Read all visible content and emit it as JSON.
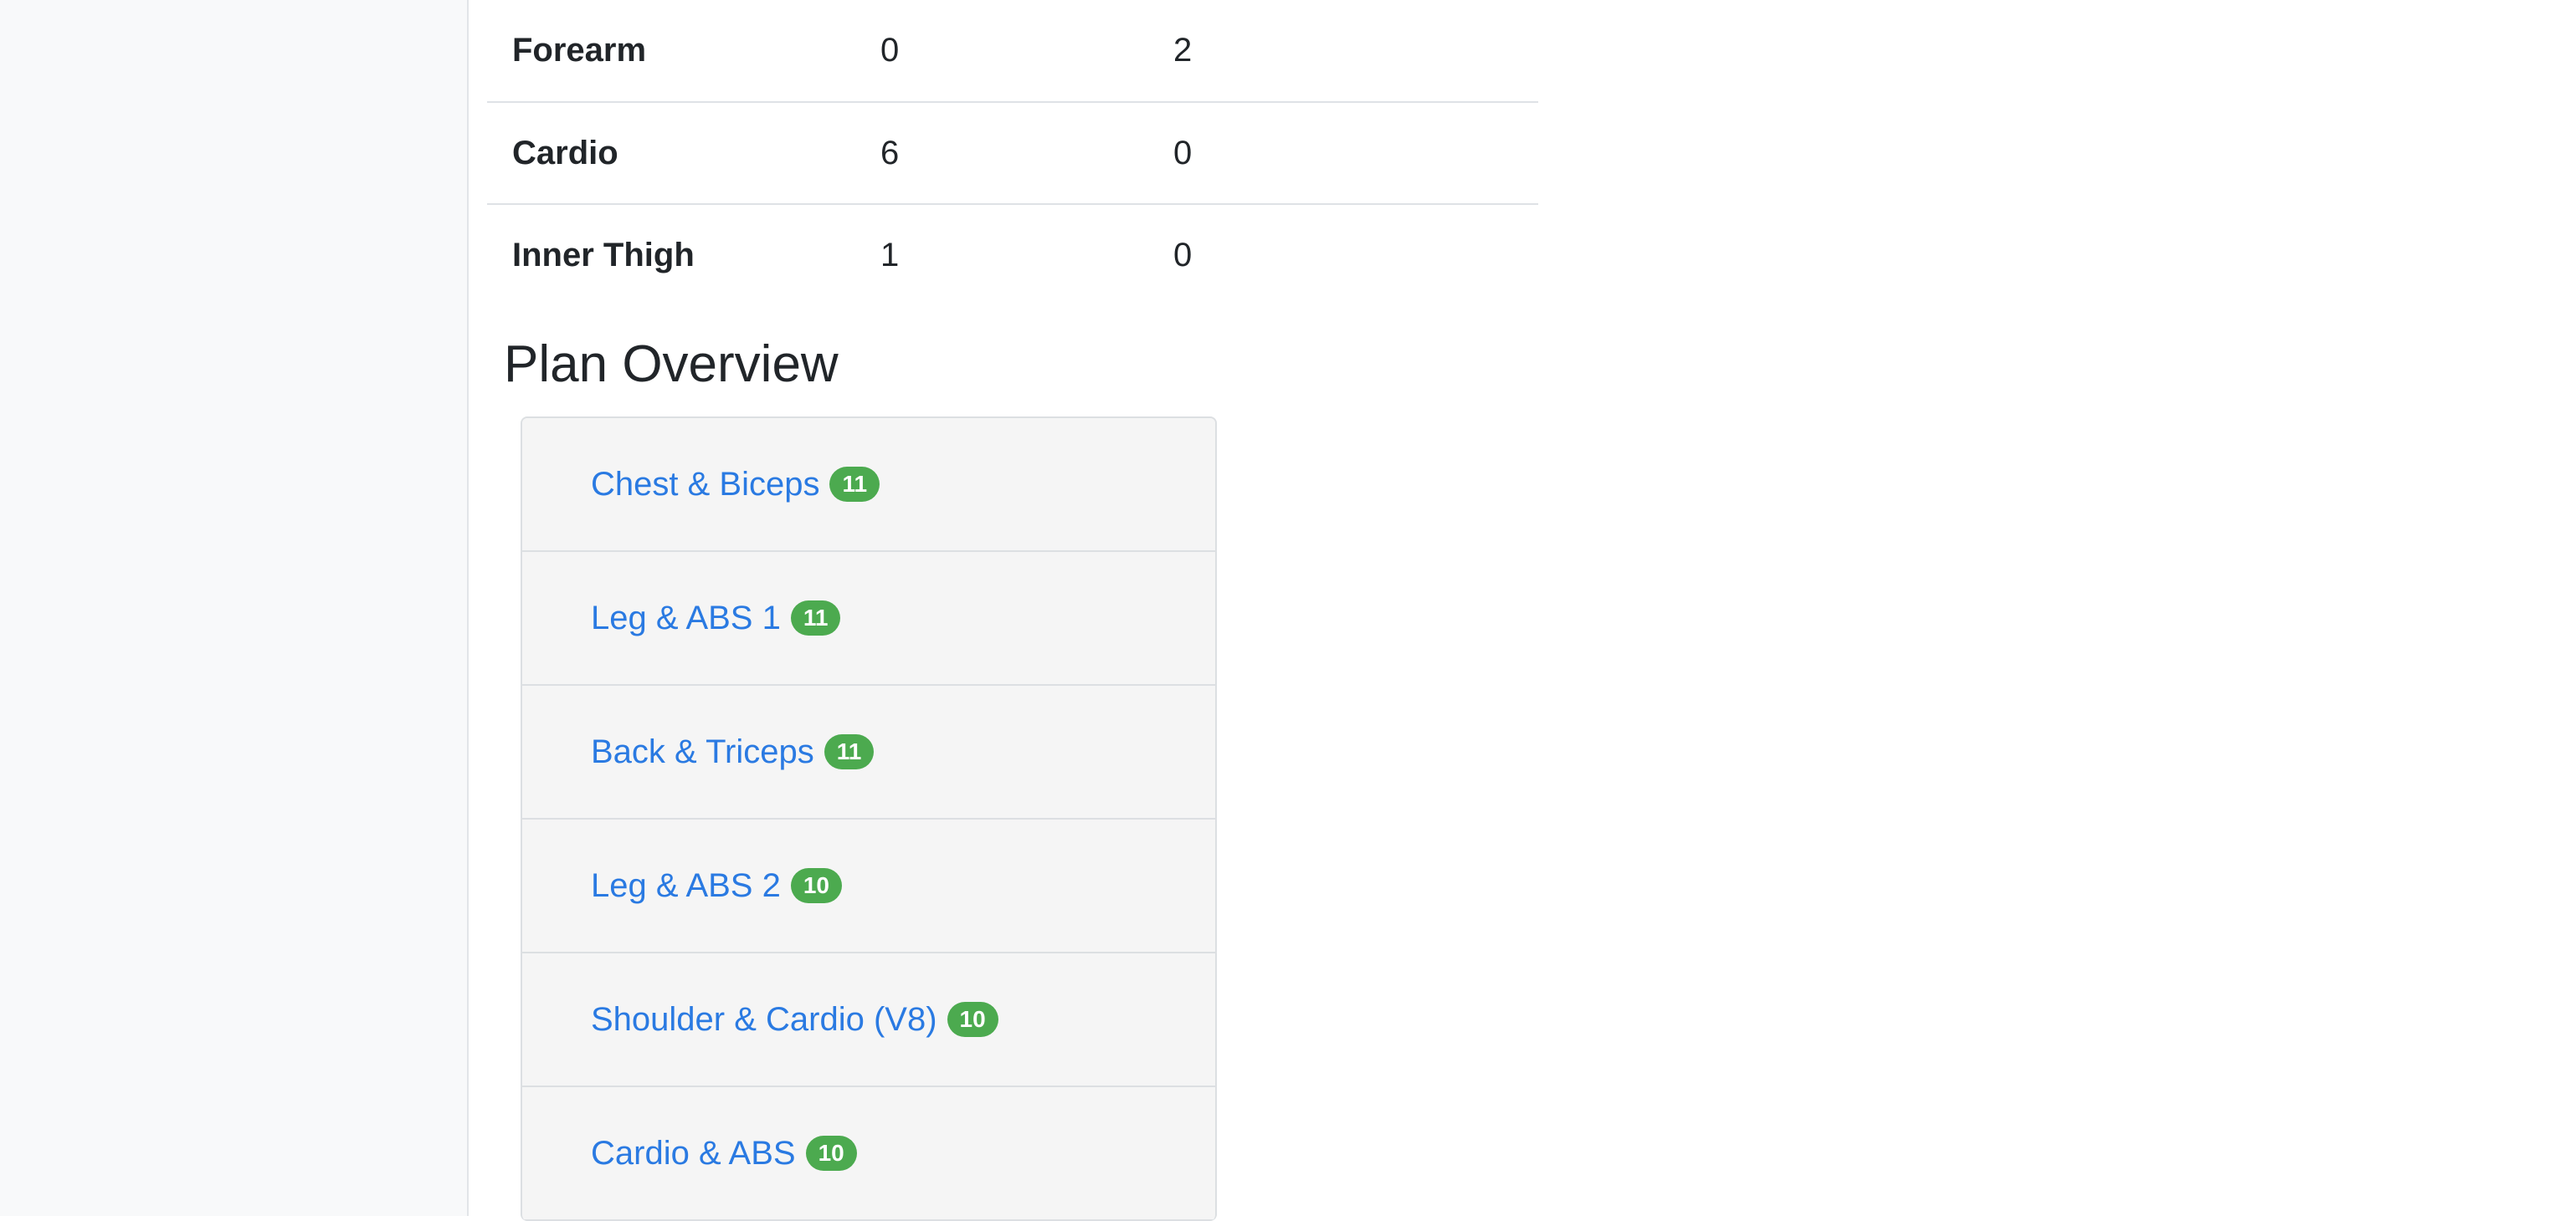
{
  "stats": {
    "rows": [
      {
        "muscle": "Forearm",
        "col1": "0",
        "col2": "2"
      },
      {
        "muscle": "Cardio",
        "col1": "6",
        "col2": "0"
      },
      {
        "muscle": "Inner Thigh",
        "col1": "1",
        "col2": "0"
      }
    ]
  },
  "plan_overview": {
    "title": "Plan Overview",
    "items": [
      {
        "label": "Chest & Biceps",
        "count": "11"
      },
      {
        "label": "Leg & ABS 1",
        "count": "11"
      },
      {
        "label": "Back & Triceps",
        "count": "11"
      },
      {
        "label": "Leg & ABS 2",
        "count": "10"
      },
      {
        "label": "Shoulder & Cardio (V8)",
        "count": "10"
      },
      {
        "label": "Cardio & ABS",
        "count": "10"
      }
    ]
  },
  "colors": {
    "link": "#2a7ae2",
    "badge": "#4caa4f",
    "sidebar_bg": "#f8f9fa"
  }
}
